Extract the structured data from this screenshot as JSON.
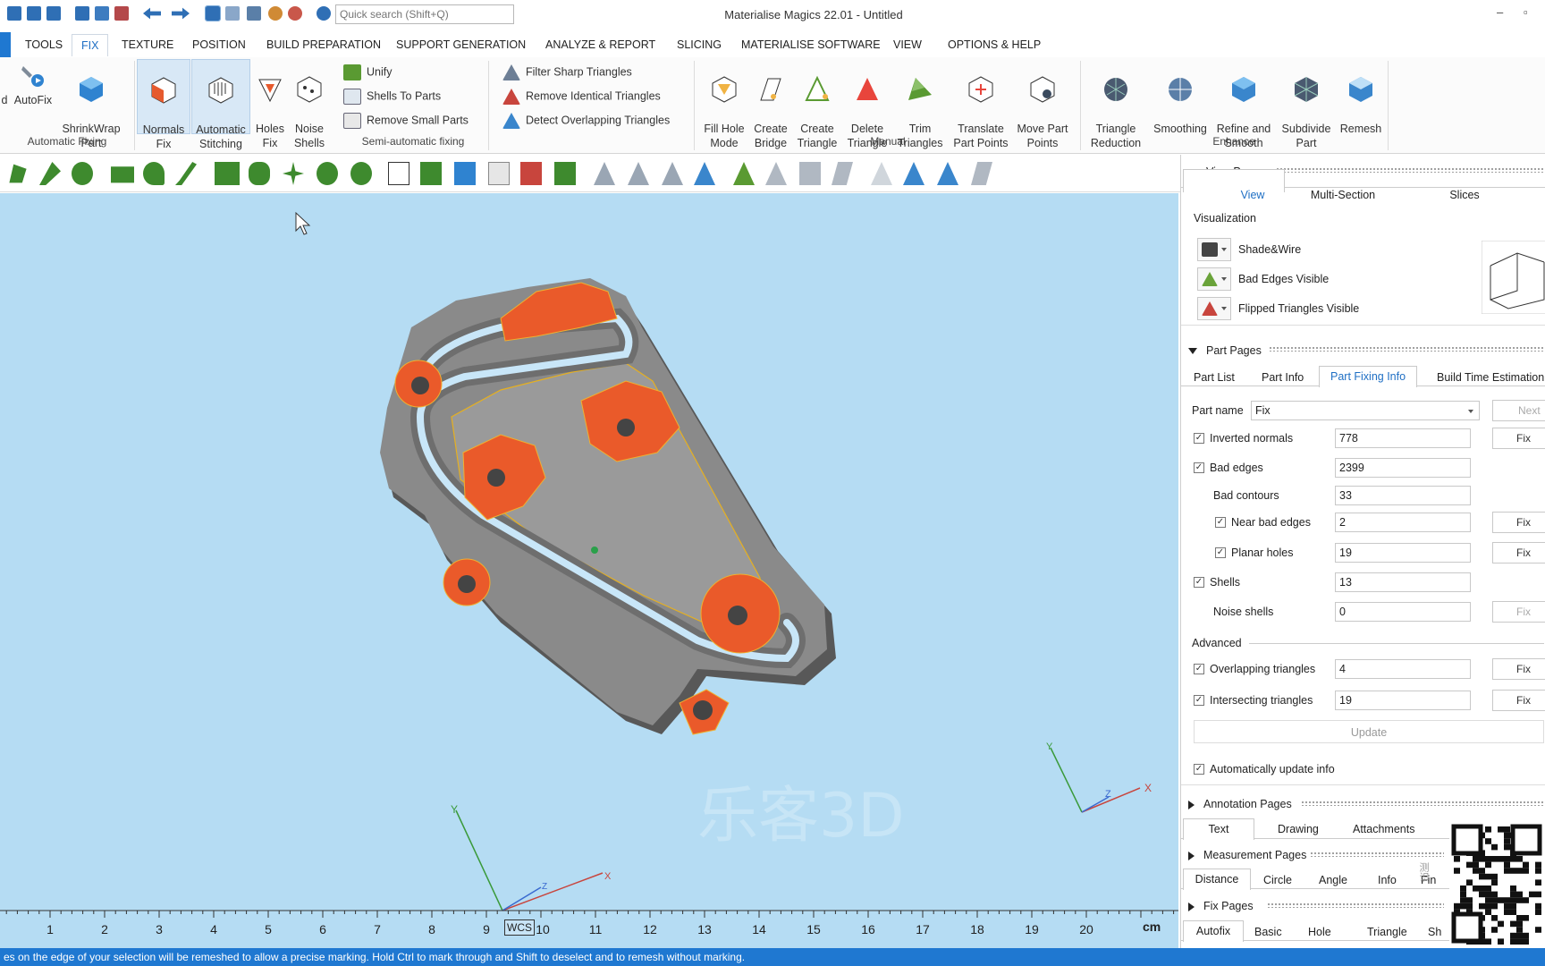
{
  "window": {
    "title": "Materialise Magics 22.01 - Untitled",
    "search_placeholder": "Quick search (Shift+Q)",
    "controls": [
      "–",
      "▫"
    ]
  },
  "menu": {
    "tabs": [
      "TOOLS",
      "FIX",
      "TEXTURE",
      "POSITION",
      "BUILD PREPARATION",
      "SUPPORT GENERATION",
      "ANALYZE & REPORT",
      "SLICING",
      "MATERIALISE SOFTWARE",
      "VIEW",
      "OPTIONS & HELP"
    ],
    "active": "FIX"
  },
  "ribbon": {
    "cut_label": "d",
    "groups": {
      "automatic": {
        "label": "Automatic Fixing",
        "autofix": "AutoFix",
        "shrinkwrap": "ShrinkWrap\nPart"
      },
      "semi": {
        "label": "Semi-automatic fixing",
        "normals": "Normals\nFix",
        "stitching": "Automatic\nStitching",
        "holes": "Holes\nFix",
        "noise": "Noise\nShells",
        "unify": "Unify",
        "shells_to_parts": "Shells To Parts",
        "remove_small": "Remove Small Parts"
      },
      "filter": {
        "sharp": "Filter Sharp Triangles",
        "identical": "Remove Identical Triangles",
        "overlapping": "Detect Overlapping Triangles"
      },
      "manual": {
        "label": "Manual",
        "fill_hole": "Fill Hole\nMode",
        "create_bridge": "Create\nBridge",
        "create_triangle": "Create\nTriangle",
        "delete_triangle": "Delete\nTriangle",
        "trim": "Trim\nTriangles",
        "translate": "Translate\nPart Points",
        "move": "Move Part\nPoints"
      },
      "enhance": {
        "label": "Enhance",
        "reduction": "Triangle\nReduction",
        "smoothing": "Smoothing",
        "refine": "Refine and\nSmooth",
        "subdivide": "Subdivide\nPart",
        "remesh": "Remesh"
      }
    }
  },
  "viewport": {
    "watermark": "乐客3D",
    "axis_labels": {
      "x": "X",
      "y": "Y",
      "z": "Z"
    },
    "wcs": "WCS",
    "ruler": [
      "1",
      "2",
      "3",
      "4",
      "5",
      "6",
      "7",
      "8",
      "9",
      "10",
      "11",
      "12",
      "13",
      "14",
      "15",
      "16",
      "17",
      "18",
      "19",
      "20"
    ],
    "ruler_unit": "cm"
  },
  "status": "es on the edge of your selection will be remeshed to allow a precise marking. Hold Ctrl to mark through and Shift to deselect and to remesh without marking.",
  "panel": {
    "view_pages": {
      "title": "View Pages",
      "tabs": [
        "View",
        "Multi-Section",
        "Slices"
      ],
      "visualization": "Visualization",
      "shade": "Shade&Wire",
      "bad_edges": "Bad Edges Visible",
      "flipped": "Flipped Triangles Visible"
    },
    "part_pages": {
      "title": "Part Pages",
      "tabs": [
        "Part List",
        "Part Info",
        "Part Fixing Info",
        "Build Time Estimation"
      ],
      "part_name_label": "Part name",
      "part_name": "Fix",
      "next": "Next",
      "fix": "Fix",
      "rows": {
        "inverted": {
          "label": "Inverted normals",
          "value": "778"
        },
        "bad_edges": {
          "label": "Bad edges",
          "value": "2399"
        },
        "bad_contours": {
          "label": "Bad contours",
          "value": "33"
        },
        "near_bad": {
          "label": "Near bad edges",
          "value": "2"
        },
        "planar": {
          "label": "Planar holes",
          "value": "19"
        },
        "shells": {
          "label": "Shells",
          "value": "13"
        },
        "noise": {
          "label": "Noise shells",
          "value": "0"
        },
        "overlapping": {
          "label": "Overlapping triangles",
          "value": "4"
        },
        "intersecting": {
          "label": "Intersecting triangles",
          "value": "19"
        }
      },
      "advanced": "Advanced",
      "update": "Update",
      "auto_update": "Automatically update info"
    },
    "annotation": {
      "title": "Annotation Pages",
      "tabs": [
        "Text",
        "Drawing",
        "Attachments"
      ]
    },
    "measurement": {
      "title": "Measurement Pages",
      "tabs": [
        "Distance",
        "Circle",
        "Angle",
        "Info",
        "Fin"
      ]
    },
    "fix_pages": {
      "title": "Fix Pages",
      "tabs": [
        "Autofix",
        "Basic",
        "Hole",
        "Triangle",
        "Sh"
      ]
    },
    "qr_text": "测识"
  }
}
